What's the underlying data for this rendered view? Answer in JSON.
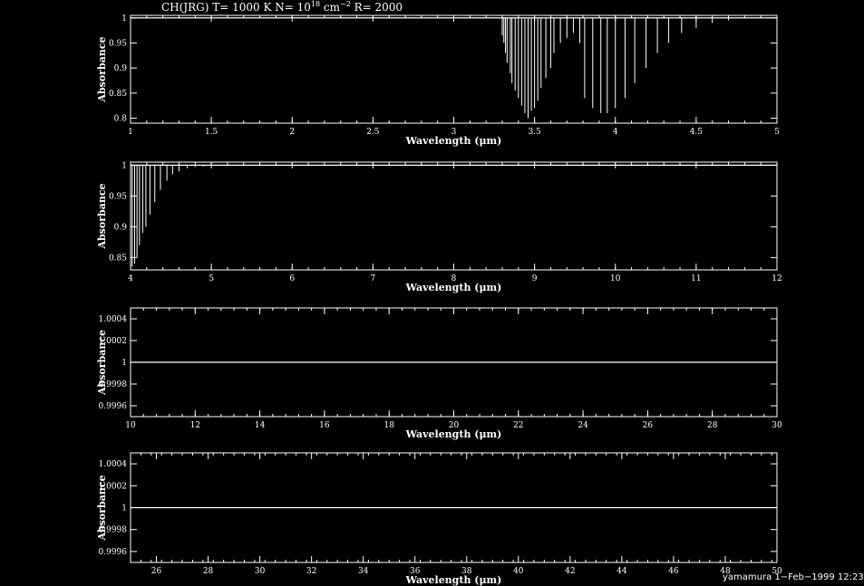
{
  "title": {
    "prefix": "CH(JRG) T= 1000 K N= 10",
    "n_exp": "18",
    "unit": " cm",
    "unit_exp": "−2",
    "suffix": " R= 2000"
  },
  "footer": "yamamura  1−Feb−1999 12:23",
  "colors": {
    "background": "#000000",
    "foreground": "#ffffff"
  },
  "chart_data": [
    {
      "type": "line",
      "xlabel": "Wavelength (μm)",
      "ylabel": "Absorbance",
      "xlim": [
        1,
        5
      ],
      "ylim": [
        0.79,
        1.005
      ],
      "xticks": [
        "1",
        "1.5",
        "2",
        "2.5",
        "3",
        "3.5",
        "4",
        "4.5",
        "5"
      ],
      "xtick_values": [
        1,
        1.5,
        2,
        2.5,
        3,
        3.5,
        4,
        4.5,
        5
      ],
      "yticks": [
        "0.8",
        "0.85",
        "0.9",
        "0.95",
        "1"
      ],
      "ytick_values": [
        0.8,
        0.85,
        0.9,
        0.95,
        1
      ],
      "baseline": 1,
      "lines": [
        {
          "x": 3.3,
          "y": 0.965
        },
        {
          "x": 3.31,
          "y": 0.95
        },
        {
          "x": 3.32,
          "y": 0.93
        },
        {
          "x": 3.33,
          "y": 0.91
        },
        {
          "x": 3.35,
          "y": 0.89
        },
        {
          "x": 3.36,
          "y": 0.87
        },
        {
          "x": 3.38,
          "y": 0.855
        },
        {
          "x": 3.4,
          "y": 0.84
        },
        {
          "x": 3.42,
          "y": 0.825
        },
        {
          "x": 3.44,
          "y": 0.81
        },
        {
          "x": 3.46,
          "y": 0.8
        },
        {
          "x": 3.48,
          "y": 0.815
        },
        {
          "x": 3.5,
          "y": 0.82
        },
        {
          "x": 3.52,
          "y": 0.835
        },
        {
          "x": 3.54,
          "y": 0.86
        },
        {
          "x": 3.57,
          "y": 0.88
        },
        {
          "x": 3.6,
          "y": 0.9
        },
        {
          "x": 3.62,
          "y": 0.93
        },
        {
          "x": 3.66,
          "y": 0.95
        },
        {
          "x": 3.7,
          "y": 0.96
        },
        {
          "x": 3.74,
          "y": 0.97
        },
        {
          "x": 3.78,
          "y": 0.95
        },
        {
          "x": 3.81,
          "y": 0.84
        },
        {
          "x": 3.86,
          "y": 0.82
        },
        {
          "x": 3.91,
          "y": 0.81
        },
        {
          "x": 3.95,
          "y": 0.81
        },
        {
          "x": 4.0,
          "y": 0.82
        },
        {
          "x": 4.06,
          "y": 0.84
        },
        {
          "x": 4.12,
          "y": 0.87
        },
        {
          "x": 4.19,
          "y": 0.9
        },
        {
          "x": 4.26,
          "y": 0.93
        },
        {
          "x": 4.33,
          "y": 0.95
        },
        {
          "x": 4.41,
          "y": 0.97
        },
        {
          "x": 4.5,
          "y": 0.98
        },
        {
          "x": 4.6,
          "y": 0.99
        },
        {
          "x": 4.7,
          "y": 0.995
        }
      ]
    },
    {
      "type": "line",
      "xlabel": "Wavelength (μm)",
      "ylabel": "Absorbance",
      "xlim": [
        4,
        12
      ],
      "ylim": [
        0.83,
        1.005
      ],
      "xticks": [
        "4",
        "5",
        "6",
        "7",
        "8",
        "9",
        "10",
        "11",
        "12"
      ],
      "xtick_values": [
        4,
        5,
        6,
        7,
        8,
        9,
        10,
        11,
        12
      ],
      "yticks": [
        "0.85",
        "0.9",
        "0.95",
        "1"
      ],
      "ytick_values": [
        0.85,
        0.9,
        0.95,
        1
      ],
      "baseline": 1,
      "lines": [
        {
          "x": 4.02,
          "y": 0.835
        },
        {
          "x": 4.05,
          "y": 0.84
        },
        {
          "x": 4.08,
          "y": 0.85
        },
        {
          "x": 4.11,
          "y": 0.87
        },
        {
          "x": 4.15,
          "y": 0.89
        },
        {
          "x": 4.19,
          "y": 0.9
        },
        {
          "x": 4.24,
          "y": 0.92
        },
        {
          "x": 4.3,
          "y": 0.94
        },
        {
          "x": 4.37,
          "y": 0.96
        },
        {
          "x": 4.45,
          "y": 0.975
        },
        {
          "x": 4.52,
          "y": 0.985
        },
        {
          "x": 4.6,
          "y": 0.99
        },
        {
          "x": 4.7,
          "y": 0.995
        },
        {
          "x": 4.8,
          "y": 0.997
        },
        {
          "x": 4.9,
          "y": 0.998
        }
      ]
    },
    {
      "type": "line",
      "xlabel": "Wavelength (μm)",
      "ylabel": "Absorbance",
      "xlim": [
        10,
        30
      ],
      "ylim": [
        0.9995,
        1.0005
      ],
      "xticks": [
        "10",
        "12",
        "14",
        "16",
        "18",
        "20",
        "22",
        "24",
        "26",
        "28",
        "30"
      ],
      "xtick_values": [
        10,
        12,
        14,
        16,
        18,
        20,
        22,
        24,
        26,
        28,
        30
      ],
      "yticks": [
        "0.9996",
        "0.9998",
        "1",
        "1.0002",
        "1.0004"
      ],
      "ytick_values": [
        0.9996,
        0.9998,
        1,
        1.0002,
        1.0004
      ],
      "baseline": 1,
      "lines": []
    },
    {
      "type": "line",
      "xlabel": "Wavelength (μm)",
      "ylabel": "Absorbance",
      "xlim": [
        25,
        50
      ],
      "ylim": [
        0.9995,
        1.0005
      ],
      "xticks": [
        "26",
        "28",
        "30",
        "32",
        "34",
        "36",
        "38",
        "40",
        "42",
        "44",
        "46",
        "48",
        "50"
      ],
      "xtick_values": [
        26,
        28,
        30,
        32,
        34,
        36,
        38,
        40,
        42,
        44,
        46,
        48,
        50
      ],
      "yticks": [
        "0.9996",
        "0.9998",
        "1",
        "1.0002",
        "1.0004"
      ],
      "ytick_values": [
        0.9996,
        0.9998,
        1,
        1.0002,
        1.0004
      ],
      "baseline": 1,
      "lines": []
    }
  ]
}
